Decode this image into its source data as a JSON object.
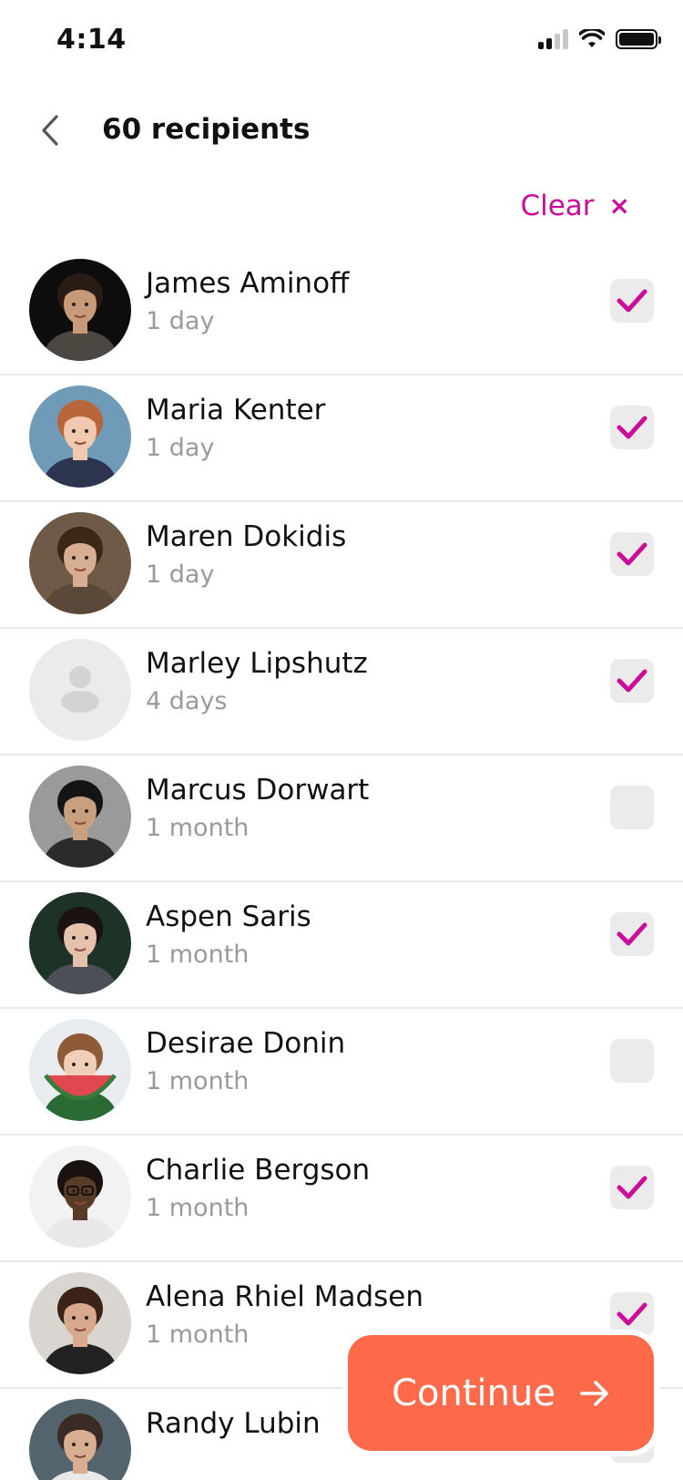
{
  "status_bar": {
    "time": "4:14"
  },
  "header": {
    "title": "60 recipients",
    "clear_label": "Clear",
    "clear_icon": "×"
  },
  "recipients": [
    {
      "name": "James Aminoff",
      "last_contact": "1 day",
      "selected": true,
      "avatar": "photo-man-dark-hair"
    },
    {
      "name": "Maria Kenter",
      "last_contact": "1 day",
      "selected": true,
      "avatar": "photo-woman-red-hair"
    },
    {
      "name": "Maren Dokidis",
      "last_contact": "1 day",
      "selected": true,
      "avatar": "photo-woman-freckles"
    },
    {
      "name": "Marley Lipshutz",
      "last_contact": "4 days",
      "selected": true,
      "avatar": "placeholder-person-icon"
    },
    {
      "name": "Marcus Dorwart",
      "last_contact": "1 month",
      "selected": false,
      "avatar": "photo-young-man"
    },
    {
      "name": "Aspen Saris",
      "last_contact": "1 month",
      "selected": true,
      "avatar": "photo-woman-dark-hair"
    },
    {
      "name": "Desirae Donin",
      "last_contact": "1 month",
      "selected": false,
      "avatar": "photo-woman-watermelon"
    },
    {
      "name": "Charlie Bergson",
      "last_contact": "1 month",
      "selected": true,
      "avatar": "photo-man-glasses"
    },
    {
      "name": "Alena Rhiel Madsen",
      "last_contact": "1 month",
      "selected": true,
      "avatar": "photo-woman-smiling"
    },
    {
      "name": "Randy Lubin",
      "last_contact": "",
      "selected": false,
      "avatar": "photo-man-smiling"
    }
  ],
  "continue_button": {
    "label": "Continue"
  },
  "colors": {
    "accent": "#cc0d9a",
    "continue_bg": "#ff6a4b",
    "checkbox_bg": "#ebebeb",
    "divider": "#e9e9e9",
    "subtext": "#9a9a9a"
  }
}
